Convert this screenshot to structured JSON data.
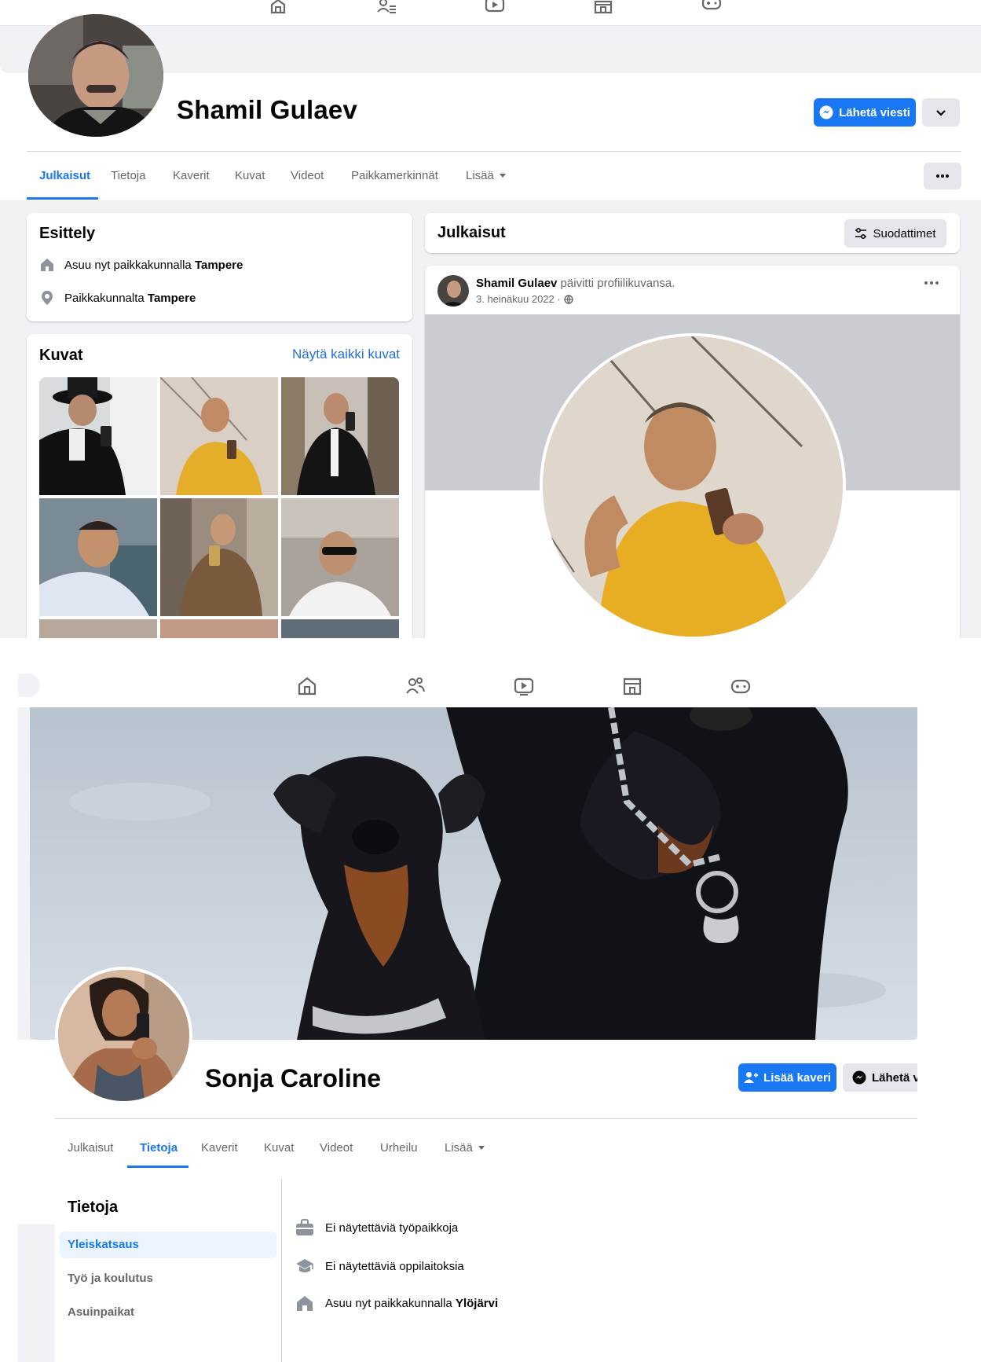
{
  "panel1": {
    "profile": {
      "name": "Shamil Gulaev"
    },
    "actions": {
      "message_label": "Lähetä viesti"
    },
    "tabs": [
      "Julkaisut",
      "Tietoja",
      "Kaverit",
      "Kuvat",
      "Videot",
      "Paikkamerkinnät",
      "Lisää"
    ],
    "intro": {
      "title": "Esittely",
      "lives_prefix": "Asuu nyt paikkakunnalla",
      "lives_city": "Tampere",
      "from_prefix": "Paikkakunnalta",
      "from_city": "Tampere"
    },
    "photos": {
      "title": "Kuvat",
      "see_all": "Näytä kaikki kuvat"
    },
    "posts": {
      "title": "Julkaisut",
      "filters_label": "Suodattimet"
    },
    "post": {
      "author": "Shamil Gulaev",
      "action": "päivitti profiilikuvansa.",
      "date": "3. heinäkuu 2022 ·"
    }
  },
  "panel2": {
    "profile": {
      "name": "Sonja Caroline"
    },
    "actions": {
      "add_friend_label": "Lisää kaveri",
      "message_label": "Lähetä vi"
    },
    "tabs": [
      "Julkaisut",
      "Tietoja",
      "Kaverit",
      "Kuvat",
      "Videot",
      "Urheilu",
      "Lisää"
    ],
    "about": {
      "title": "Tietoja",
      "sidebar": [
        "Yleiskatsaus",
        "Työ ja koulutus",
        "Asuinpaikat"
      ],
      "rows": {
        "work": "Ei näytettäviä työpaikkoja",
        "education": "Ei näytettäviä oppilaitoksia",
        "lives_prefix": "Asuu nyt paikkakunnalla",
        "lives_city": "Ylöjärvi"
      }
    }
  },
  "colors": {
    "accent": "#1877f2",
    "page_bg": "#f0f2f5",
    "secondary_text": "#65676b"
  },
  "icons": [
    "home-icon",
    "friends-icon",
    "watch-icon",
    "marketplace-icon",
    "gaming-icon",
    "messenger-icon",
    "add-friend-icon",
    "chevron-down-icon",
    "more-icon",
    "filters-icon",
    "house-icon",
    "location-pin-icon",
    "globe-icon",
    "briefcase-icon",
    "graduation-cap-icon"
  ]
}
